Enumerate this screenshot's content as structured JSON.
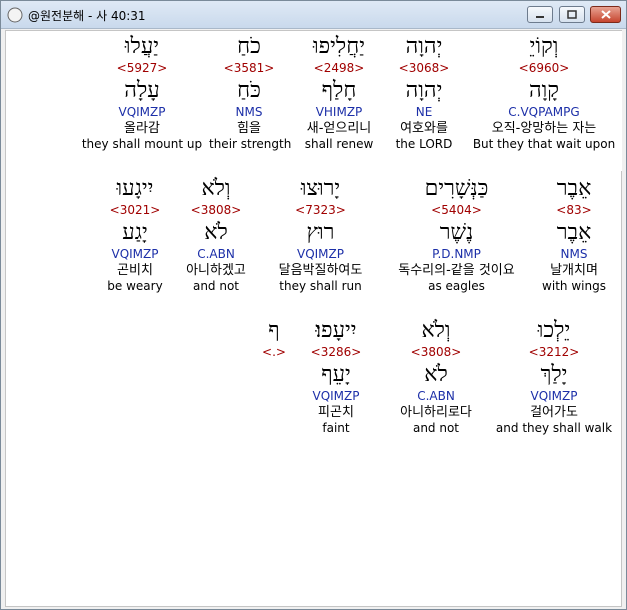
{
  "window": {
    "title": "@원전분해 - 사 40:31",
    "icon": "compass-icon",
    "buttons": {
      "minimize": "minimize-icon",
      "maximize": "maximize-icon",
      "close": "close-icon"
    }
  },
  "rows": [
    {
      "words": [
        {
          "heb": "וְקוֹיֵ",
          "strong": "<6960>",
          "lemma": "קָוָה",
          "parse": "C.VQPAMPG",
          "korean": "오직-앙망하는 자는",
          "english": "But they that wait upon"
        },
        {
          "heb": "יְהוָה",
          "strong": "<3068>",
          "lemma": "יְהוָה",
          "parse": "NE",
          "korean": "여호와를",
          "english": "the LORD"
        },
        {
          "heb": "יַחֲלִיפוּ",
          "strong": "<2498>",
          "lemma": "חָלַף",
          "parse": "VHIMZP",
          "korean": "새-얻으리니",
          "english": "shall renew"
        },
        {
          "heb": "כֹחַ",
          "strong": "<3581>",
          "lemma": "כֹּחַ",
          "parse": "NMS",
          "korean": "힘을",
          "english": "their strength"
        },
        {
          "heb": "יַעֲלוּ",
          "strong": "<5927>",
          "lemma": "עָלָה",
          "parse": "VQIMZP",
          "korean": "올라감",
          "english": "they shall mount up"
        }
      ]
    },
    {
      "words": [
        {
          "heb": "אֵבֶר",
          "strong": "<83>",
          "lemma": "אֵבֶר",
          "parse": "NMS",
          "korean": "날개치며",
          "english": "with wings"
        },
        {
          "heb": "כַּנְּשָׁרִים",
          "strong": "<5404>",
          "lemma": "נֶשֶׁר",
          "parse": "P.D.NMP",
          "korean": "독수리의-같을 것이요",
          "english": "as eagles"
        },
        {
          "heb": "יָרוּצוּ",
          "strong": "<7323>",
          "lemma": "רוּץ",
          "parse": "VQIMZP",
          "korean": "달음박질하여도",
          "english": "they shall run"
        },
        {
          "heb": "וְלֹא",
          "strong": "<3808>",
          "lemma": "לֹא",
          "parse": "C.ABN",
          "korean": "아니하겠고",
          "english": "and not"
        },
        {
          "heb": "יִיגָעוּ",
          "strong": "<3021>",
          "lemma": "יָגַע",
          "parse": "VQIMZP",
          "korean": "곤비치",
          "english": "be weary"
        }
      ]
    },
    {
      "words": [
        {
          "heb": "יֵלְכוּ",
          "strong": "<3212>",
          "lemma": "יָלַךְ",
          "parse": "VQIMZP",
          "korean": "걸어가도",
          "english": "and they shall walk"
        },
        {
          "heb": "וְלֹא",
          "strong": "<3808>",
          "lemma": "לֹא",
          "parse": "C.ABN",
          "korean": "아니하리로다",
          "english": "and not"
        },
        {
          "heb": "יִיעָפוּ׃",
          "strong": "<3286>",
          "lemma": "יָעֵף",
          "parse": "VQIMZP",
          "korean": "피곤치",
          "english": "faint"
        },
        {
          "heb": "ף",
          "strong": "<.>",
          "lemma": "",
          "parse": "",
          "korean": "",
          "english": ""
        }
      ]
    }
  ]
}
